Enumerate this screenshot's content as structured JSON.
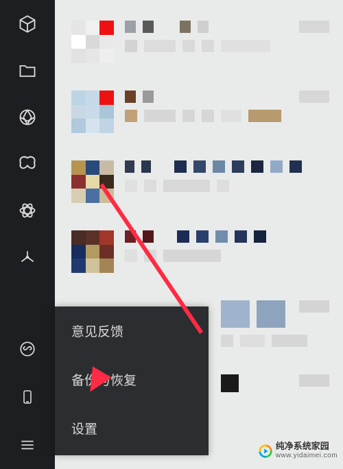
{
  "sidebar": {
    "top": [
      "cube",
      "folder",
      "aperture",
      "butterfly",
      "atom",
      "spark"
    ],
    "bottom": [
      "chain",
      "phone",
      "menu"
    ]
  },
  "popup": {
    "items": [
      {
        "label": "意见反馈"
      },
      {
        "label": "备份与恢复"
      },
      {
        "label": "设置"
      }
    ]
  },
  "watermark": {
    "title": "纯净系统家园",
    "url": "www.yidaimei.com"
  },
  "annotation": {
    "arrow_target": "设置",
    "color": "#ff2a43"
  }
}
